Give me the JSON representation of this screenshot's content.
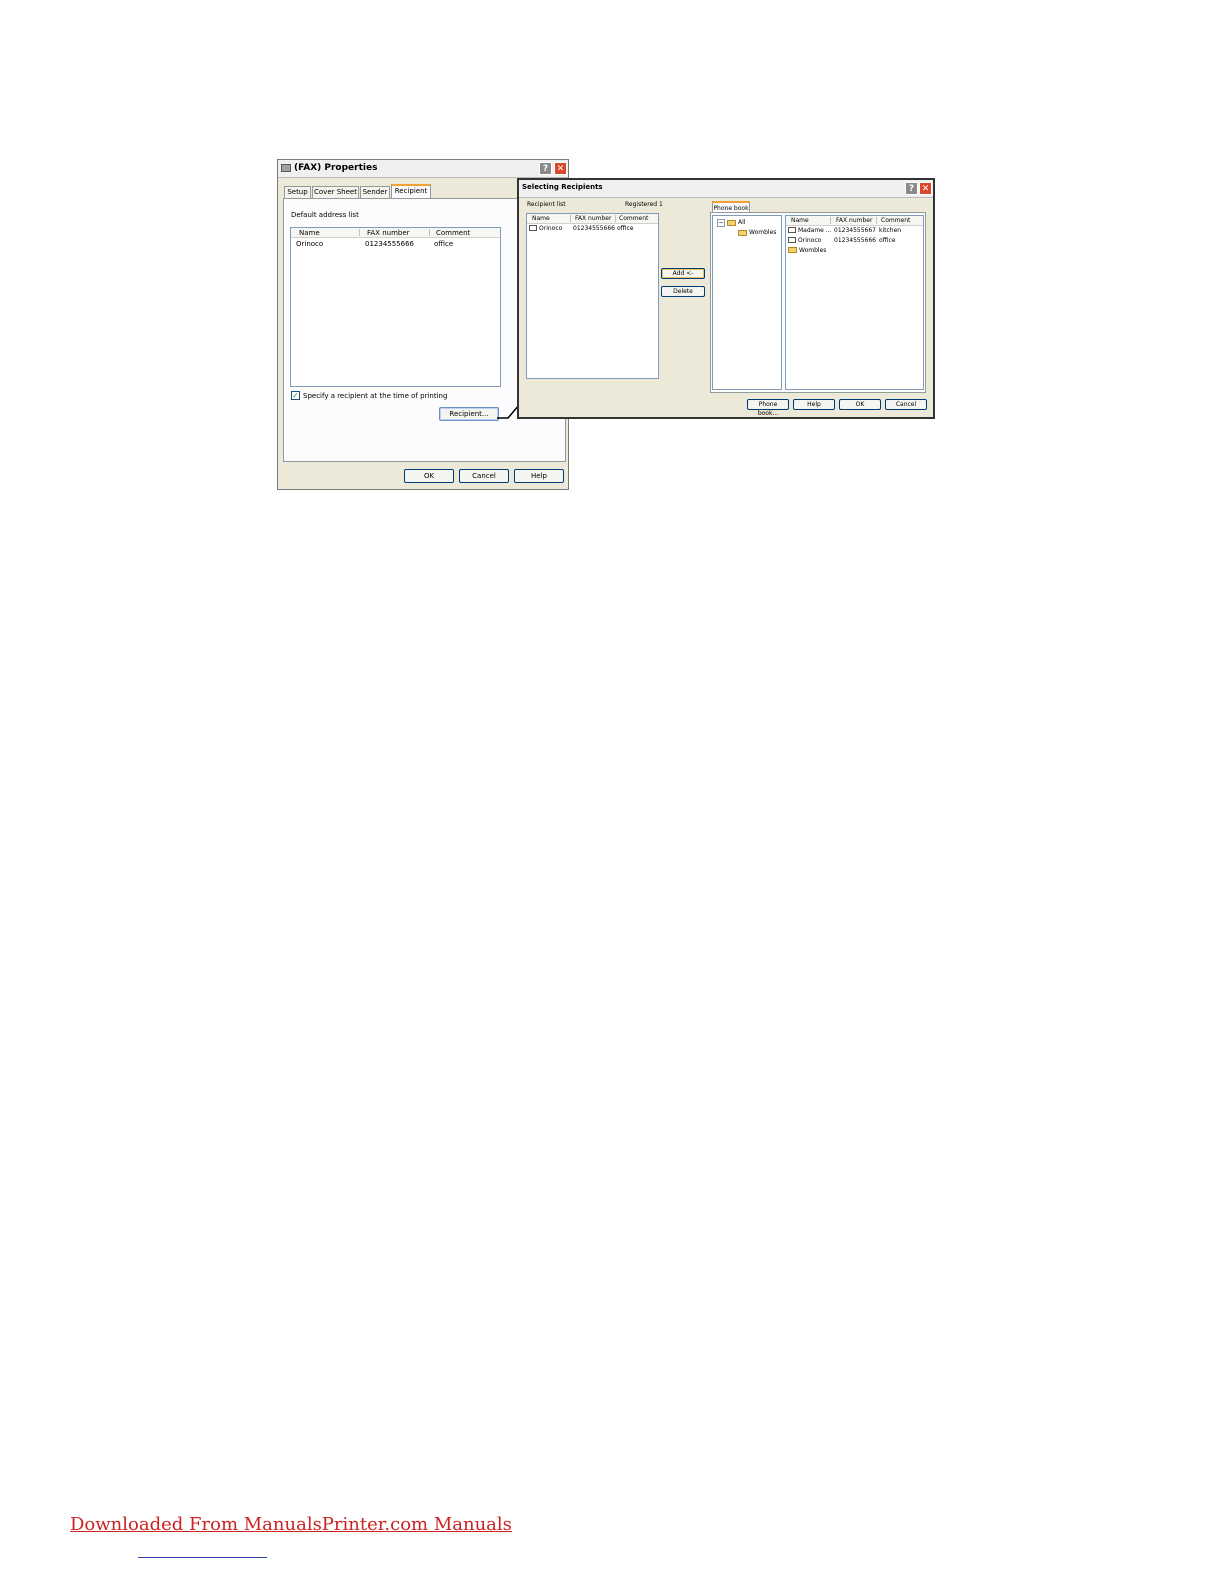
{
  "fax_properties": {
    "title": "(FAX) Properties",
    "tabs": [
      "Setup",
      "Cover Sheet",
      "Sender",
      "Recipient"
    ],
    "default_address_label": "Default address list",
    "columns": [
      "Name",
      "FAX number",
      "Comment"
    ],
    "rows": [
      {
        "name": "Orinoco",
        "fax": "01234555666",
        "comment": "office"
      }
    ],
    "checkbox_label": "Specify a recipient at the time of printing",
    "checkbox_checked": true,
    "recipient_button": "Recipient...",
    "ok": "OK",
    "cancel": "Cancel",
    "help": "Help"
  },
  "selecting_recipients": {
    "title": "Selecting Recipients",
    "recipient_list_label": "Recipient list",
    "registered_label": "Registered 1",
    "columns": [
      "Name",
      "FAX number",
      "Comment"
    ],
    "rows": [
      {
        "name": "Orinoco",
        "fax": "01234555666",
        "comment": "office"
      }
    ],
    "add_button": "Add <-",
    "delete_button": "Delete",
    "phonebook_tab": "Phone book",
    "tree": {
      "root": "All",
      "child": "Wombles"
    },
    "pb_columns": [
      "Name",
      "FAX number",
      "Comment"
    ],
    "pb_rows": [
      {
        "name": "Madame ...",
        "fax": "01234555667",
        "comment": "kitchen"
      },
      {
        "name": "Orinoco",
        "fax": "01234555666",
        "comment": "office"
      },
      {
        "name": "Wombles",
        "fax": "",
        "comment": ""
      }
    ],
    "phonebook_button": "Phone book...",
    "help": "Help",
    "ok": "OK",
    "cancel": "Cancel"
  },
  "footer": {
    "link_text": "Downloaded From ManualsPrinter.com Manuals"
  }
}
